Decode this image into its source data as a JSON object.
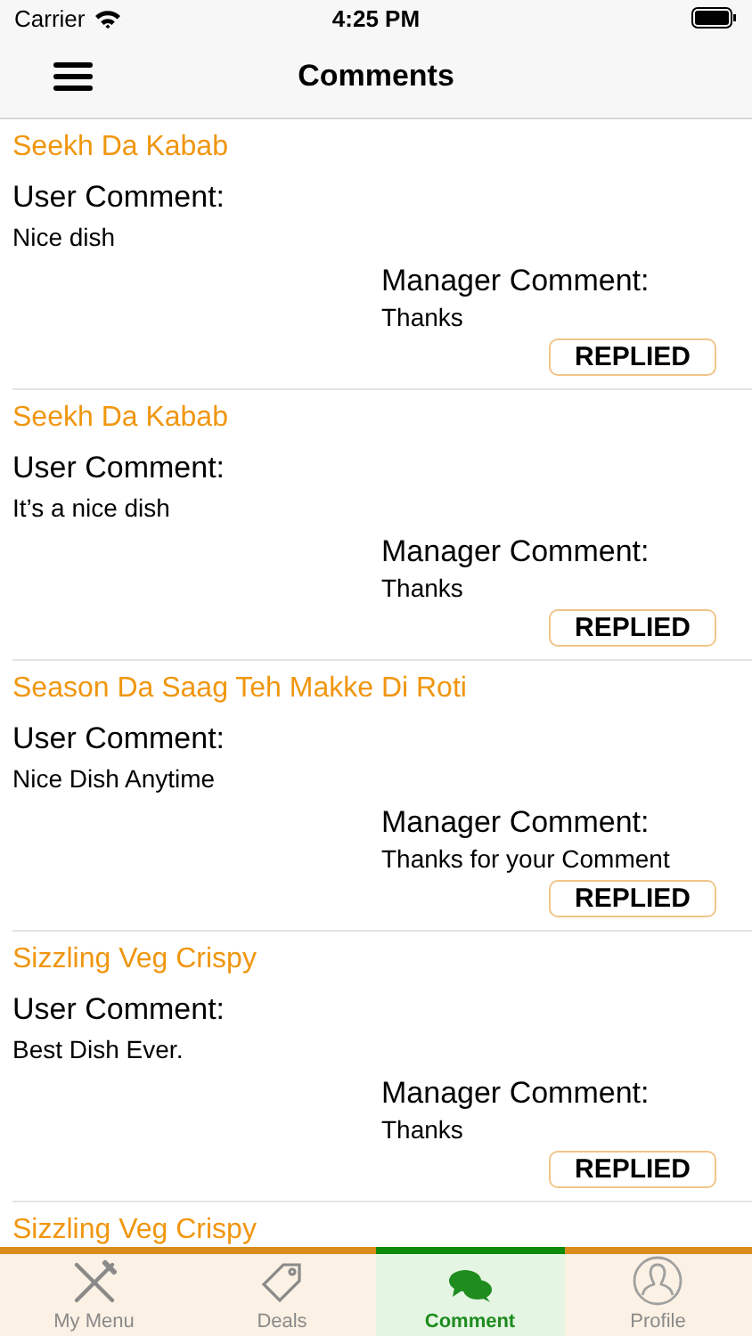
{
  "status_bar": {
    "carrier": "Carrier",
    "time": "4:25 PM"
  },
  "nav": {
    "title": "Comments"
  },
  "comments": [
    {
      "dish": "Seekh Da Kabab",
      "user_label": "User Comment:",
      "user_comment": "Nice dish",
      "manager_label": "Manager Comment:",
      "manager_comment": "Thanks",
      "status": "REPLIED"
    },
    {
      "dish": "Seekh Da Kabab",
      "user_label": "User Comment:",
      "user_comment": "It’s a nice dish",
      "manager_label": "Manager Comment:",
      "manager_comment": "Thanks",
      "status": "REPLIED"
    },
    {
      "dish": "Season Da Saag Teh Makke Di Roti",
      "user_label": "User Comment:",
      "user_comment": "Nice Dish Anytime",
      "manager_label": "Manager Comment:",
      "manager_comment": "Thanks for your Comment",
      "status": "REPLIED"
    },
    {
      "dish": "Sizzling Veg Crispy",
      "user_label": "User Comment:",
      "user_comment": "Best Dish Ever.",
      "manager_label": "Manager Comment:",
      "manager_comment": "Thanks",
      "status": "REPLIED"
    },
    {
      "dish": "Sizzling Veg Crispy"
    }
  ],
  "tabs": [
    {
      "kind": "menu",
      "label": "My Menu",
      "selected": false
    },
    {
      "kind": "deals",
      "label": "Deals",
      "selected": false
    },
    {
      "kind": "comment",
      "label": "Comment",
      "selected": true
    },
    {
      "kind": "profile",
      "label": "Profile",
      "selected": false
    }
  ]
}
